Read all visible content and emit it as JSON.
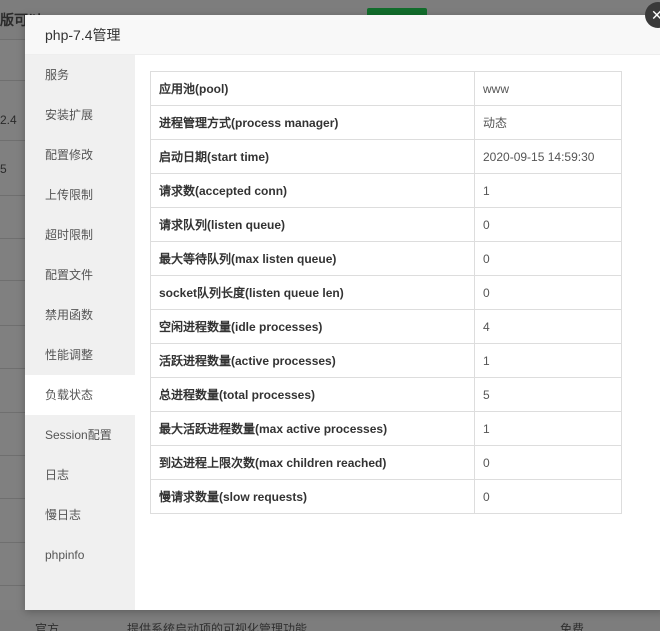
{
  "background": {
    "top_text": "版可以…",
    "left_values": [
      "2.4",
      "5"
    ],
    "bottom_left": "官方",
    "bottom_mid": "提供系统启动项的可视化管理功能",
    "bottom_right": "免费",
    "close_glyph": "✕"
  },
  "modal": {
    "title": "php-7.4管理",
    "sidebar": [
      {
        "label": "服务",
        "active": false
      },
      {
        "label": "安装扩展",
        "active": false
      },
      {
        "label": "配置修改",
        "active": false
      },
      {
        "label": "上传限制",
        "active": false
      },
      {
        "label": "超时限制",
        "active": false
      },
      {
        "label": "配置文件",
        "active": false
      },
      {
        "label": "禁用函数",
        "active": false
      },
      {
        "label": "性能调整",
        "active": false
      },
      {
        "label": "负载状态",
        "active": true
      },
      {
        "label": "Session配置",
        "active": false
      },
      {
        "label": "日志",
        "active": false
      },
      {
        "label": "慢日志",
        "active": false
      },
      {
        "label": "phpinfo",
        "active": false
      }
    ],
    "status_rows": [
      {
        "key": "应用池(pool)",
        "value": "www"
      },
      {
        "key": "进程管理方式(process manager)",
        "value": "动态"
      },
      {
        "key": "启动日期(start time)",
        "value": "2020-09-15 14:59:30"
      },
      {
        "key": "请求数(accepted conn)",
        "value": "1"
      },
      {
        "key": "请求队列(listen queue)",
        "value": "0"
      },
      {
        "key": "最大等待队列(max listen queue)",
        "value": "0"
      },
      {
        "key": "socket队列长度(listen queue len)",
        "value": "0"
      },
      {
        "key": "空闲进程数量(idle processes)",
        "value": "4"
      },
      {
        "key": "活跃进程数量(active processes)",
        "value": "1"
      },
      {
        "key": "总进程数量(total processes)",
        "value": "5"
      },
      {
        "key": "最大活跃进程数量(max active processes)",
        "value": "1"
      },
      {
        "key": "到达进程上限次数(max children reached)",
        "value": "0"
      },
      {
        "key": "慢请求数量(slow requests)",
        "value": "0"
      }
    ]
  },
  "colors": {
    "overlay": "#808080",
    "sidebar_bg": "#f0f0f0",
    "accent_green": "#126d2c"
  }
}
